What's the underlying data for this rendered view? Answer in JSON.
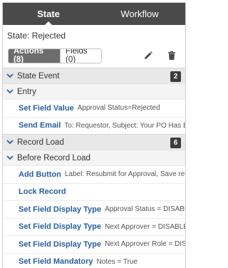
{
  "tabs": [
    {
      "label": "State"
    },
    {
      "label": "Workflow"
    }
  ],
  "state_line": "State: Rejected",
  "toolbar": {
    "actions_label": "Actions (8)",
    "fields_label": "Fields (0)"
  },
  "sections": [
    {
      "label": "State Event",
      "badge": "2",
      "subsection": {
        "label": "Entry",
        "rows": [
          {
            "action": "Set Field Value",
            "detail": "Approval Status=Rejected"
          },
          {
            "action": "Send Email",
            "detail": "To: Requestor, Subject: Your PO Has B..."
          }
        ]
      }
    },
    {
      "label": "Record Load",
      "badge": "6",
      "subsection": {
        "label": "Before Record Load",
        "rows": [
          {
            "action": "Add Button",
            "detail": "Label: Resubmit for Approval, Save re..."
          },
          {
            "action": "Lock Record",
            "detail": ""
          },
          {
            "action": "Set Field Display Type",
            "detail": "Approval Status = DISABLED"
          },
          {
            "action": "Set Field Display Type",
            "detail": "Next Approver = DISABLED"
          },
          {
            "action": "Set Field Display Type",
            "detail": "Next Approver Role = DIS..."
          },
          {
            "action": "Set Field Mandatory",
            "detail": "Notes = True"
          }
        ]
      }
    }
  ],
  "colors": {
    "tabbar": "#4a4a4a",
    "action_link": "#2a5f9e",
    "chevron": "#3f6fa8",
    "badge": "#3c3c3c"
  },
  "icons": [
    "pencil-icon",
    "trash-icon",
    "chevron-down-icon"
  ]
}
